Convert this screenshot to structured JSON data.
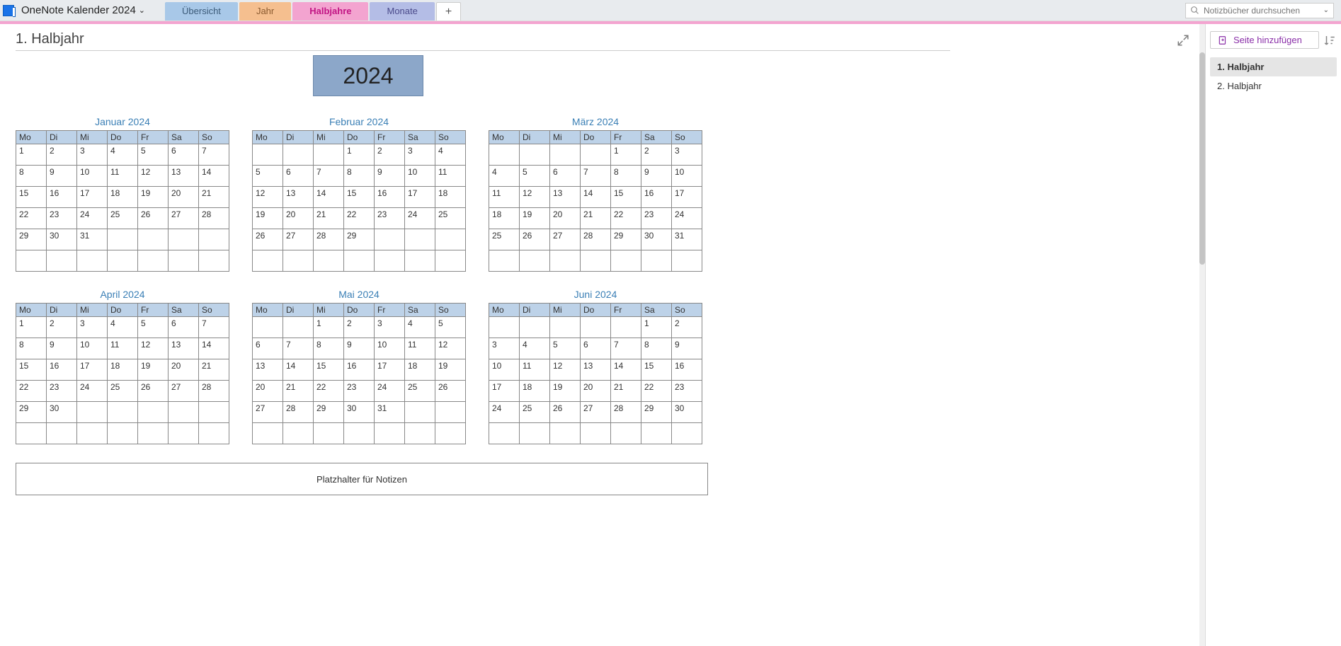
{
  "notebook": {
    "title": "OneNote Kalender 2024"
  },
  "tabs": {
    "overview": "Übersicht",
    "year": "Jahr",
    "half": "Halbjahre",
    "month": "Monate"
  },
  "search": {
    "placeholder": "Notizbücher durchsuchen"
  },
  "page": {
    "title": "1. Halbjahr",
    "year": "2024",
    "notes_placeholder": "Platzhalter für Notizen"
  },
  "sidebar": {
    "add_page": "Seite hinzufügen",
    "pages": [
      "1. Halbjahr",
      "2. Halbjahr"
    ]
  },
  "days": [
    "Mo",
    "Di",
    "Mi",
    "Do",
    "Fr",
    "Sa",
    "So"
  ],
  "months": [
    {
      "title": "Januar 2024",
      "offset": 0,
      "ndays": 31
    },
    {
      "title": "Februar 2024",
      "offset": 3,
      "ndays": 29
    },
    {
      "title": "März 2024",
      "offset": 4,
      "ndays": 31
    },
    {
      "title": "April 2024",
      "offset": 0,
      "ndays": 30
    },
    {
      "title": "Mai 2024",
      "offset": 2,
      "ndays": 31
    },
    {
      "title": "Juni 2024",
      "offset": 5,
      "ndays": 30
    }
  ]
}
